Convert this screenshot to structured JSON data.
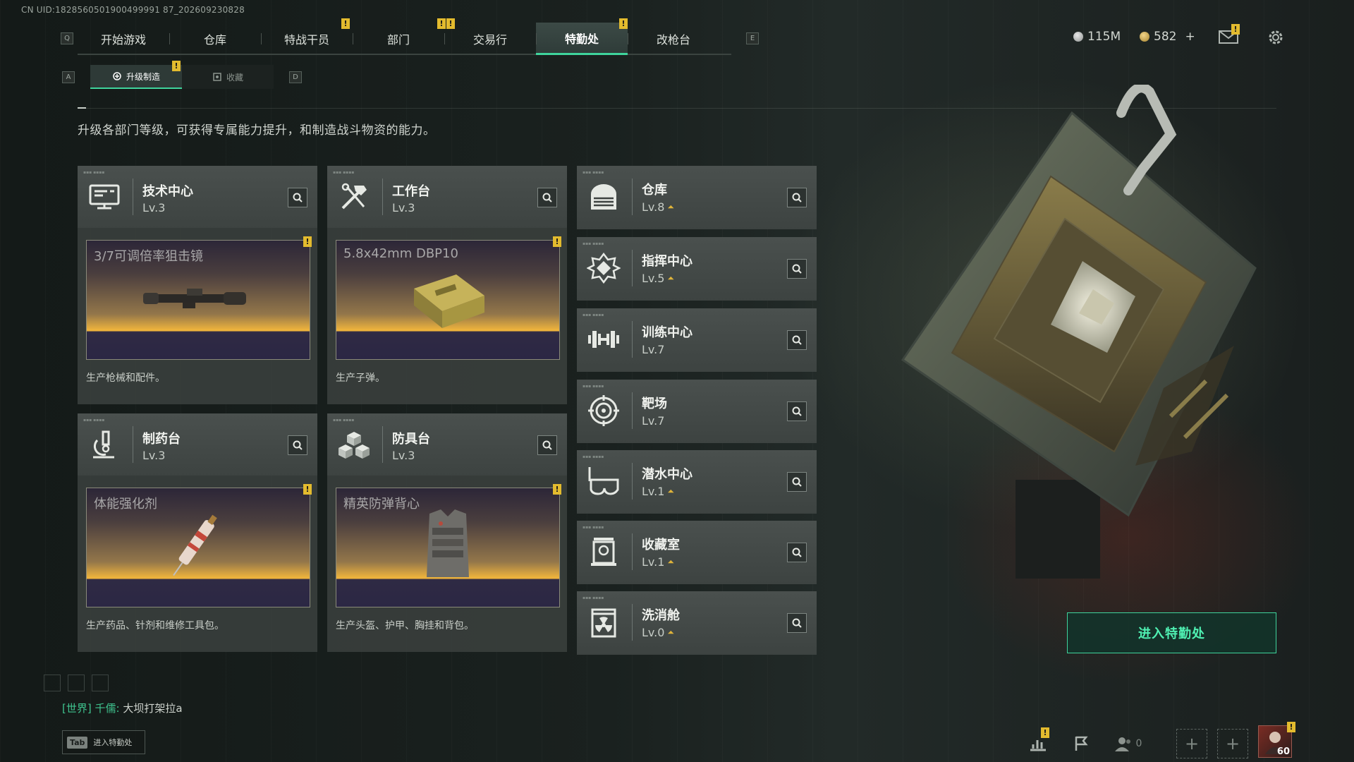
{
  "uid_text": "CN UID:1828560501900499991 87_202609230828",
  "nav": {
    "key_left": "Q",
    "key_right": "E",
    "tabs": [
      {
        "label": "开始游戏",
        "badge": ""
      },
      {
        "label": "仓库",
        "badge": ""
      },
      {
        "label": "特战干员",
        "badge": "!"
      },
      {
        "label": "部门",
        "badge": ""
      },
      {
        "label": "交易行",
        "badge": "!"
      },
      {
        "label": "特勤处",
        "badge": "!"
      },
      {
        "label": "改枪台",
        "badge": ""
      }
    ]
  },
  "currency": {
    "silver": "115M",
    "gold": "582",
    "add": "+"
  },
  "subtabs": {
    "key_left": "A",
    "key_right": "D",
    "upgrade": "升级制造",
    "collect": "收藏",
    "badge": "!"
  },
  "description": "升级各部门等级，可获得专属能力提升，和制造战斗物资的能力。",
  "big_cards": [
    {
      "name": "技术中心",
      "level": "Lv.3",
      "product": "3/7可调倍率狙击镜",
      "desc": "生产枪械和配件。",
      "icon": "monitor-icon"
    },
    {
      "name": "工作台",
      "level": "Lv.3",
      "product": "5.8x42mm DBP10",
      "desc": "生产子弹。",
      "icon": "tools-icon"
    },
    {
      "name": "制药台",
      "level": "Lv.3",
      "product": "体能强化剂",
      "desc": "生产药品、针剂和维修工具包。",
      "icon": "microscope-icon"
    },
    {
      "name": "防具台",
      "level": "Lv.3",
      "product": "精英防弹背心",
      "desc": "生产头盔、护甲、胸挂和背包。",
      "icon": "cubes-icon"
    }
  ],
  "rows": [
    {
      "name": "仓库",
      "level": "Lv.8",
      "upgrade": true,
      "icon": "warehouse-icon"
    },
    {
      "name": "指挥中心",
      "level": "Lv.5",
      "upgrade": true,
      "icon": "command-icon"
    },
    {
      "name": "训练中心",
      "level": "Lv.7",
      "upgrade": false,
      "icon": "dumbbell-icon"
    },
    {
      "name": "靶场",
      "level": "Lv.7",
      "upgrade": false,
      "icon": "target-icon"
    },
    {
      "name": "潜水中心",
      "level": "Lv.1",
      "upgrade": true,
      "icon": "diving-mask-icon"
    },
    {
      "name": "收藏室",
      "level": "Lv.1",
      "upgrade": true,
      "icon": "collection-icon"
    },
    {
      "name": "洗消舱",
      "level": "Lv.0",
      "upgrade": true,
      "icon": "radiation-icon"
    }
  ],
  "enter_button": "进入特勤处",
  "chat": {
    "channel": "[世界]",
    "name": "千儒:",
    "message": "大坝打架拉a"
  },
  "tab_hint": {
    "key": "Tab",
    "label": "进入特勤处"
  },
  "bottom_bar": {
    "friends_count": "0",
    "avatar_level": "60"
  },
  "colors": {
    "accent": "#3fd49c",
    "badge": "#e3bb2e"
  }
}
